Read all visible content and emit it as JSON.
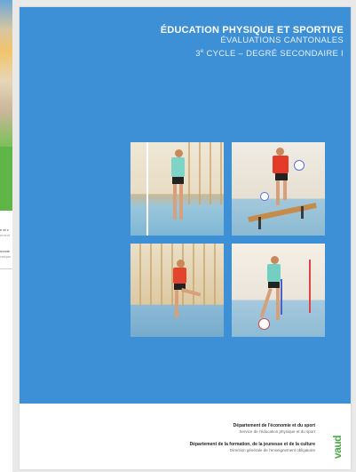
{
  "left_page": {
    "line1": "e et c",
    "line2": "ement",
    "line3": "nomie",
    "line4": "ratique"
  },
  "cover": {
    "title_line1": "ÉDUCATION PHYSIQUE ET SPORTIVE",
    "title_line2": "ÉVALUATIONS CANTONALES",
    "title_line3": "3e CYCLE – DEGRÉ SECONDAIRE I",
    "dept1_title": "Département de l'économie et du sport",
    "dept1_sub": "Service de l'éducation physique et du sport",
    "dept2_title": "Département de la formation, de la jeunesse et de la culture",
    "dept2_sub": "Direction générale de l'enseignement obligatoire",
    "logo_text": "vaud"
  },
  "colors": {
    "cover_blue": "#3d8fd6",
    "logo_green": "#4aa847"
  }
}
